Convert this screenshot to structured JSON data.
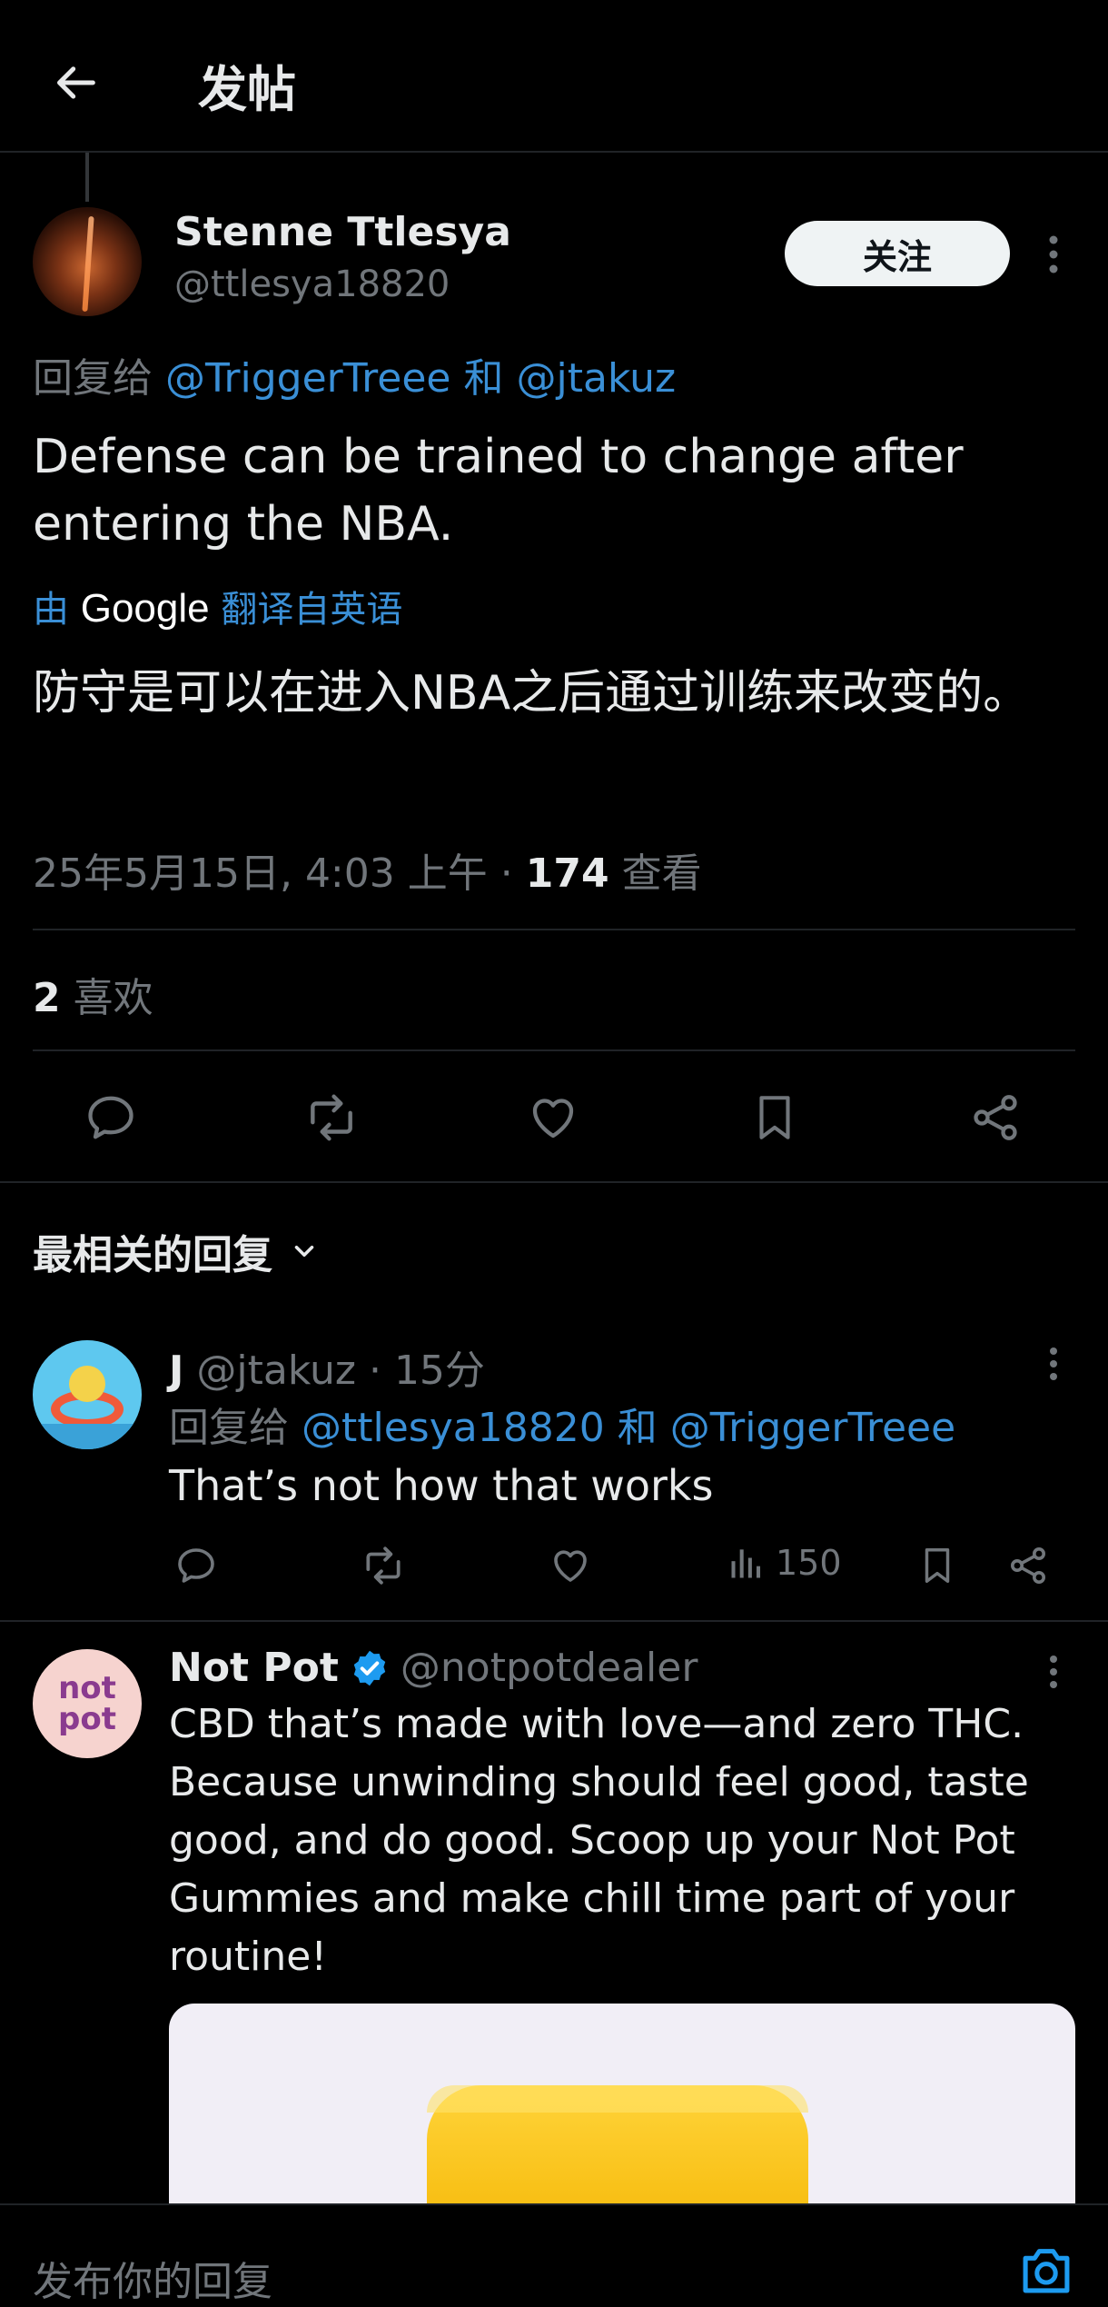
{
  "header": {
    "title": "发帖"
  },
  "post": {
    "author_name": "Stenne Ttlesya",
    "author_handle": "@ttlesya18820",
    "follow_label": "关注",
    "reply_prefix": "回复给",
    "reply_to_1": "@TriggerTreee",
    "reply_and": "和",
    "reply_to_2": "@jtakuz",
    "text": "Defense can be trained to change after entering the NBA.",
    "translate_prefix": "由",
    "translate_brand": "Google",
    "translate_suffix": "翻译自英语",
    "translated_text": "防守是可以在进入NBA之后通过训练来改变的。",
    "timestamp": "25年5月15日, 4:03 上午",
    "separator": "·",
    "views_count": "174",
    "views_label": "查看",
    "likes_count": "2",
    "likes_label": "喜欢"
  },
  "replies_section": {
    "label": "最相关的回复"
  },
  "reply": {
    "author_name": "J",
    "author_handle": "@jtakuz",
    "separator": "·",
    "time": "15分",
    "reply_prefix": "回复给",
    "reply_to_1": "@ttlesya18820",
    "reply_and": "和",
    "reply_to_2": "@TriggerTreee",
    "text": "That’s not how that works",
    "views": "150"
  },
  "ad": {
    "author_name": "Not Pot",
    "author_handle": "@notpotdealer",
    "avatar_text_1": "not",
    "avatar_text_2": "pot",
    "text": "CBD that’s made with love—and zero THC. Because unwinding should feel good, taste good, and do good. Scoop up your Not Pot Gummies and make chill time part of your routine!"
  },
  "composer": {
    "placeholder": "发布你的回复"
  },
  "colors": {
    "background": "#000000",
    "link": "#3a8fd6",
    "muted": "#71767b",
    "verified": "#1d9bf0"
  }
}
